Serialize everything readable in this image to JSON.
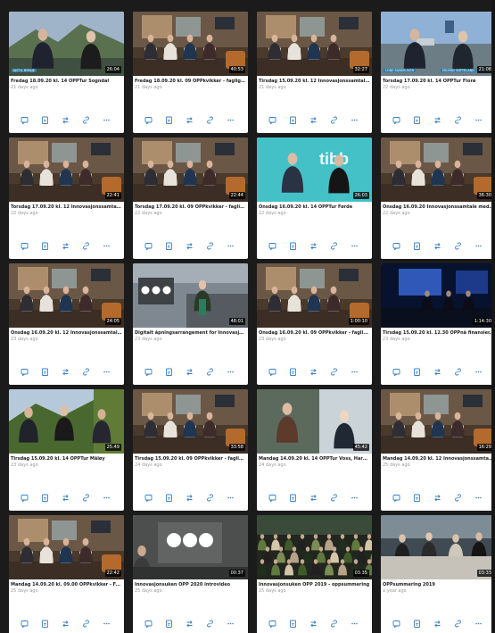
{
  "videos": [
    {
      "title": "Fredag 18.09.20 kl. 14 OPPTur Sogndal",
      "age": "21 days ago",
      "duration": "26:04",
      "scene": "duo",
      "names": [
        "KJETIL BYRKJE",
        ""
      ]
    },
    {
      "title": "Fredag 18.09.20 kl. 09 OPPkvikker - faglig ...",
      "age": "21 days ago",
      "duration": "40:53",
      "scene": "panel"
    },
    {
      "title": "Tirsdag 15.09.20 kl. 12 Innovasjonssamtal...",
      "age": "21 days ago",
      "duration": "32:27",
      "scene": "panel"
    },
    {
      "title": "Torsdag 17.09.20 kl. 14 OPPTur Florø",
      "age": "22 days ago",
      "duration": "21:08",
      "scene": "duo-out",
      "names": [
        "LONE SANDS-IVER",
        "ERLEND SØFTELAND"
      ]
    },
    {
      "title": "Torsdag 17.09.20 kl. 12 Innovasjonssamtal...",
      "age": "22 days ago",
      "duration": "22:41",
      "scene": "panel"
    },
    {
      "title": "Torsdag 17.09.20 kl. 09 OPPkvikker - faglig...",
      "age": "22 days ago",
      "duration": "22:44",
      "scene": "panel"
    },
    {
      "title": "Onsdag 16.09.20 kl. 14 OPPTur Førde",
      "age": "22 days ago",
      "duration": "26:03",
      "scene": "tibber"
    },
    {
      "title": "Onsdag 16.09.20 Innovasjonssamtale med...",
      "age": "22 days ago",
      "duration": "36:30",
      "scene": "panel"
    },
    {
      "title": "Onsdag 16.09.20 kl. 12 Innovasjonssamtal...",
      "age": "23 days ago",
      "duration": "24:05",
      "scene": "panel"
    },
    {
      "title": "Digitalt åpningsarrangement for Innovasjo...",
      "age": "23 days ago",
      "duration": "48:01",
      "scene": "warehouse"
    },
    {
      "title": "Onsdag 16.09.20 kl. 09 OPPkvikker - fagli...",
      "age": "23 days ago",
      "duration": "1:00:10",
      "scene": "panel"
    },
    {
      "title": "Tirsdag 15.09.20 kl. 12.30 OPPnå finansier...",
      "age": "23 days ago",
      "duration": "1:14:30",
      "scene": "stage"
    },
    {
      "title": "Tirsdag 15.09.20 kl. 14 OPPTur Måløy",
      "age": "23 days ago",
      "duration": "25:49",
      "scene": "trio-out"
    },
    {
      "title": "Tirsdag 15.09.20 kl. 09 OPPkvikker - faglig...",
      "age": "24 days ago",
      "duration": "33:58",
      "scene": "panel"
    },
    {
      "title": "Mandag 14.09.20 kl. 14 OPPTur Voss, Hard...",
      "age": "24 days ago",
      "duration": "45:42",
      "scene": "duo-voss"
    },
    {
      "title": "Mandag 14.09.20 kl. 12 Innovasjonssamtal...",
      "age": "25 days ago",
      "duration": "16:29",
      "scene": "panel"
    },
    {
      "title": "Mandag 14.09.20 kl. 09.00 OPPkvikker - F...",
      "age": "25 days ago",
      "duration": "22:42",
      "scene": "panel"
    },
    {
      "title": "Innovasjonsuken OPP 2020 introvideo",
      "age": "25 days ago",
      "duration": "00:37",
      "scene": "intro"
    },
    {
      "title": "Innovasjonsuken OPP 2019 - oppsummering",
      "age": "25 days ago",
      "duration": "03:35",
      "scene": "crowd"
    },
    {
      "title": "OPPsummering 2019",
      "age": "a year ago",
      "duration": "03:33",
      "scene": "table"
    }
  ],
  "action_icons": [
    "comment-icon",
    "post-icon",
    "share-icon",
    "link-icon",
    "more-icon"
  ],
  "colors": {
    "background": "#1b1b1b",
    "card": "#ffffff",
    "title": "#222222",
    "age": "#9a9a9a",
    "icon": "#3a7fc1"
  }
}
